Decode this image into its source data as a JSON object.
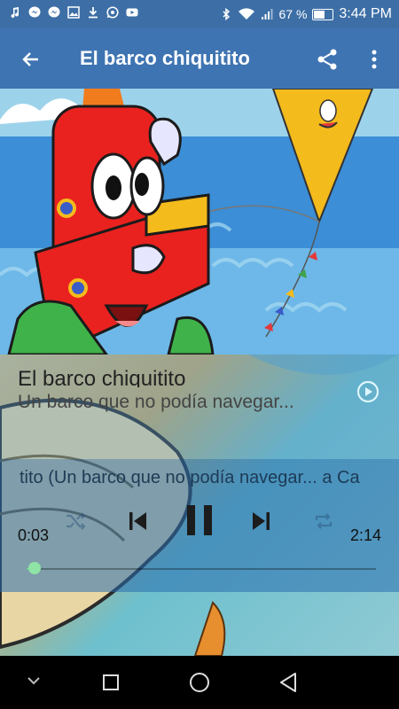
{
  "status_bar": {
    "left_icons": [
      "music-note-icon",
      "messenger-icon",
      "messenger-icon",
      "image-icon",
      "download-icon",
      "whatsapp-icon",
      "youtube-icon"
    ],
    "battery": "67 %",
    "battery_level": 0.67,
    "time": "3:44 PM"
  },
  "app_bar": {
    "title": "El barco chiquitito"
  },
  "now_playing": {
    "title": "El barco chiquitito",
    "subtitle": "Un barco que no podía navegar...",
    "scrolling_text": "tito (Un barco que no podía navegar... a Ca"
  },
  "player": {
    "elapsed": "0:03",
    "duration": "2:14",
    "progress": 0.023
  },
  "colors": {
    "app_bar": "#3f74b2",
    "status_bar": "#3d6fa6",
    "progress_accent": "#6fd08c"
  }
}
